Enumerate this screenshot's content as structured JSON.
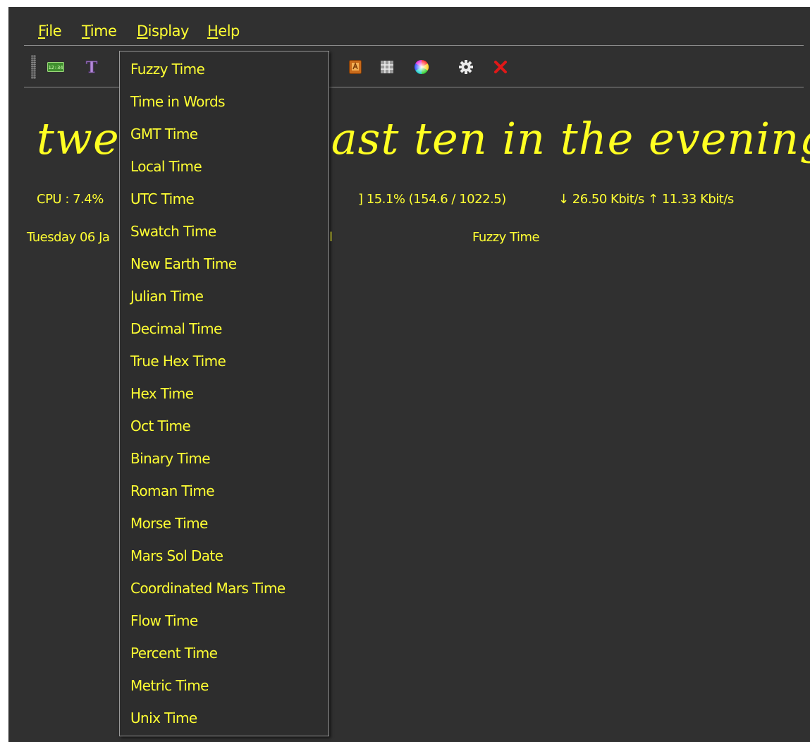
{
  "menubar": {
    "items": [
      {
        "mnemonic": "F",
        "rest": "ile"
      },
      {
        "mnemonic": "T",
        "rest": "ime"
      },
      {
        "mnemonic": "D",
        "rest": "isplay"
      },
      {
        "mnemonic": "H",
        "rest": "elp"
      }
    ]
  },
  "toolbar": {
    "digital_icon_text": "12:34",
    "font_icon_text": "T",
    "icons": [
      "digital-clock-icon",
      "font-icon",
      "alarm-icon",
      "grid-icon",
      "color-wheel-icon",
      "settings-icon",
      "close-icon"
    ]
  },
  "main": {
    "big_time_left": "twe",
    "big_time_right": "ast ten in the evening",
    "cpu": "CPU : 7.4%",
    "memory": "] 15.1% (154.6 / 1022.5)",
    "network": "↓ 26.50 Kbit/s ↑ 11.33 Kbit/s",
    "date": "Tuesday 06 Ja",
    "date_tail": "l",
    "time_mode": "Fuzzy Time"
  },
  "dropdown": {
    "items": [
      "Fuzzy Time",
      "Time in Words",
      "GMT Time",
      "Local Time",
      "UTC Time",
      "Swatch Time",
      "New Earth Time",
      "Julian Time",
      "Decimal Time",
      "True Hex Time",
      "Hex Time",
      "Oct Time",
      "Binary Time",
      "Roman Time",
      "Morse Time",
      "Mars Sol Date",
      "Coordinated Mars Time",
      "Flow Time",
      "Percent Time",
      "Metric Time",
      "Unix Time"
    ]
  },
  "colors": {
    "background": "#303030",
    "text": "#ffff33"
  }
}
